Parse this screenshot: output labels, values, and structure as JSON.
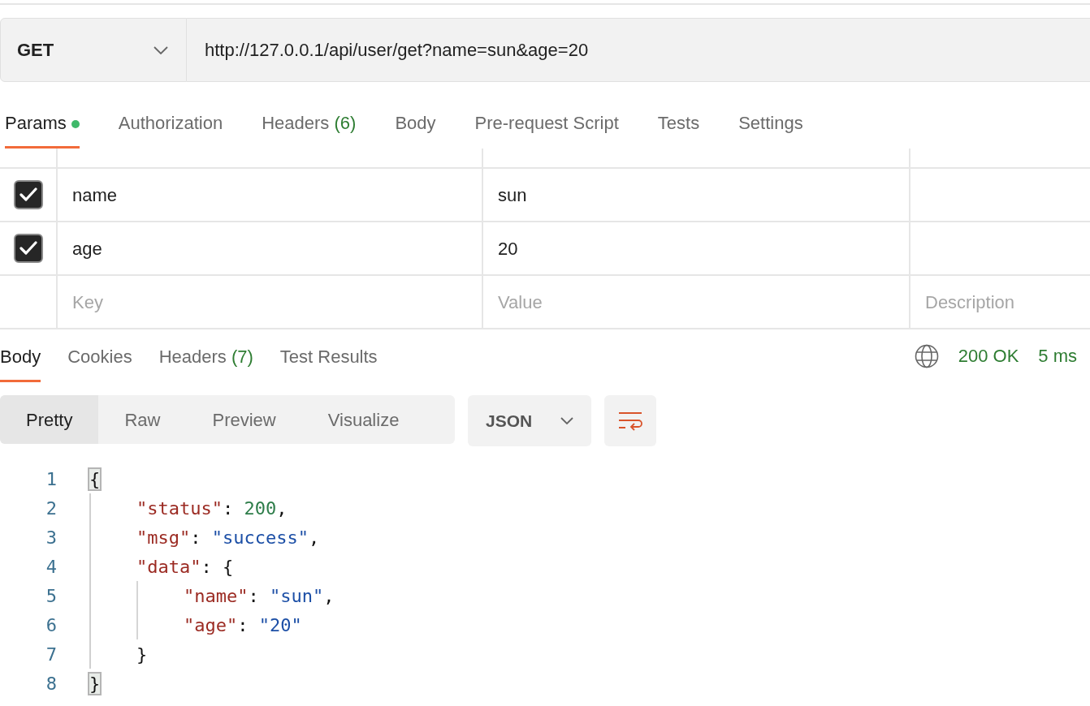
{
  "request": {
    "method": "GET",
    "url": "http://127.0.0.1/api/user/get?name=sun&age=20"
  },
  "request_tabs": [
    {
      "label": "Params",
      "dot": true,
      "selected": true
    },
    {
      "label": "Authorization",
      "selected": false
    },
    {
      "label": "Headers",
      "count": "(6)",
      "selected": false
    },
    {
      "label": "Body",
      "selected": false
    },
    {
      "label": "Pre-request Script",
      "selected": false
    },
    {
      "label": "Tests",
      "selected": false
    },
    {
      "label": "Settings",
      "selected": false
    }
  ],
  "params": {
    "rows": [
      {
        "checked": true,
        "key": "name",
        "value": "sun"
      },
      {
        "checked": true,
        "key": "age",
        "value": "20"
      }
    ],
    "new_row": {
      "key_placeholder": "Key",
      "value_placeholder": "Value",
      "description_placeholder": "Description"
    }
  },
  "response_tabs": [
    {
      "label": "Body",
      "selected": true
    },
    {
      "label": "Cookies",
      "selected": false
    },
    {
      "label": "Headers",
      "count": "(7)",
      "selected": false
    },
    {
      "label": "Test Results",
      "selected": false
    }
  ],
  "response_status": {
    "status": "200 OK",
    "time": "5 ms"
  },
  "view_modes": [
    {
      "label": "Pretty",
      "selected": true
    },
    {
      "label": "Raw",
      "selected": false
    },
    {
      "label": "Preview",
      "selected": false
    },
    {
      "label": "Visualize",
      "selected": false
    }
  ],
  "format": "JSON",
  "code": [
    {
      "number": "1",
      "tokens": [
        {
          "kind": "brace",
          "text": "{",
          "matched": true
        }
      ]
    },
    {
      "number": "2",
      "tokens": [
        {
          "kind": "key",
          "text": "\"status\""
        },
        {
          "kind": "punct",
          "text": ": "
        },
        {
          "kind": "number",
          "text": "200"
        },
        {
          "kind": "punct",
          "text": ","
        }
      ]
    },
    {
      "number": "3",
      "tokens": [
        {
          "kind": "key",
          "text": "\"msg\""
        },
        {
          "kind": "punct",
          "text": ": "
        },
        {
          "kind": "string",
          "text": "\"success\""
        },
        {
          "kind": "punct",
          "text": ","
        }
      ]
    },
    {
      "number": "4",
      "tokens": [
        {
          "kind": "key",
          "text": "\"data\""
        },
        {
          "kind": "punct",
          "text": ": "
        },
        {
          "kind": "brace",
          "text": "{",
          "matched": false
        }
      ]
    },
    {
      "number": "5",
      "tokens": [
        {
          "kind": "key",
          "text": "\"name\""
        },
        {
          "kind": "punct",
          "text": ": "
        },
        {
          "kind": "string",
          "text": "\"sun\""
        },
        {
          "kind": "punct",
          "text": ","
        }
      ]
    },
    {
      "number": "6",
      "tokens": [
        {
          "kind": "key",
          "text": "\"age\""
        },
        {
          "kind": "punct",
          "text": ": "
        },
        {
          "kind": "string",
          "text": "\"20\""
        }
      ]
    },
    {
      "number": "7",
      "tokens": [
        {
          "kind": "brace",
          "text": "}",
          "matched": false
        }
      ]
    },
    {
      "number": "8",
      "tokens": [
        {
          "kind": "brace",
          "text": "}",
          "matched": true
        }
      ]
    }
  ]
}
